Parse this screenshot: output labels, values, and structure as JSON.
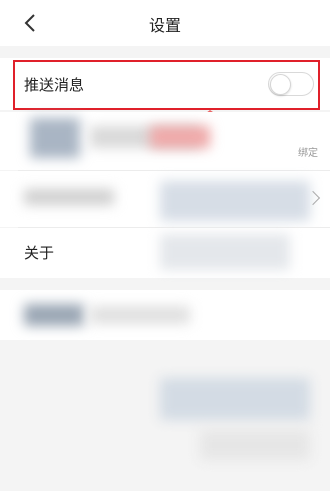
{
  "header": {
    "title": "设置",
    "back_icon": "chevron-left-icon"
  },
  "settings": {
    "push": {
      "label": "推送消息",
      "enabled": false
    },
    "bind_status": "绑定",
    "about": {
      "label": "关于"
    }
  },
  "colors": {
    "highlight": "#e0202a",
    "background": "#f4f4f4"
  }
}
